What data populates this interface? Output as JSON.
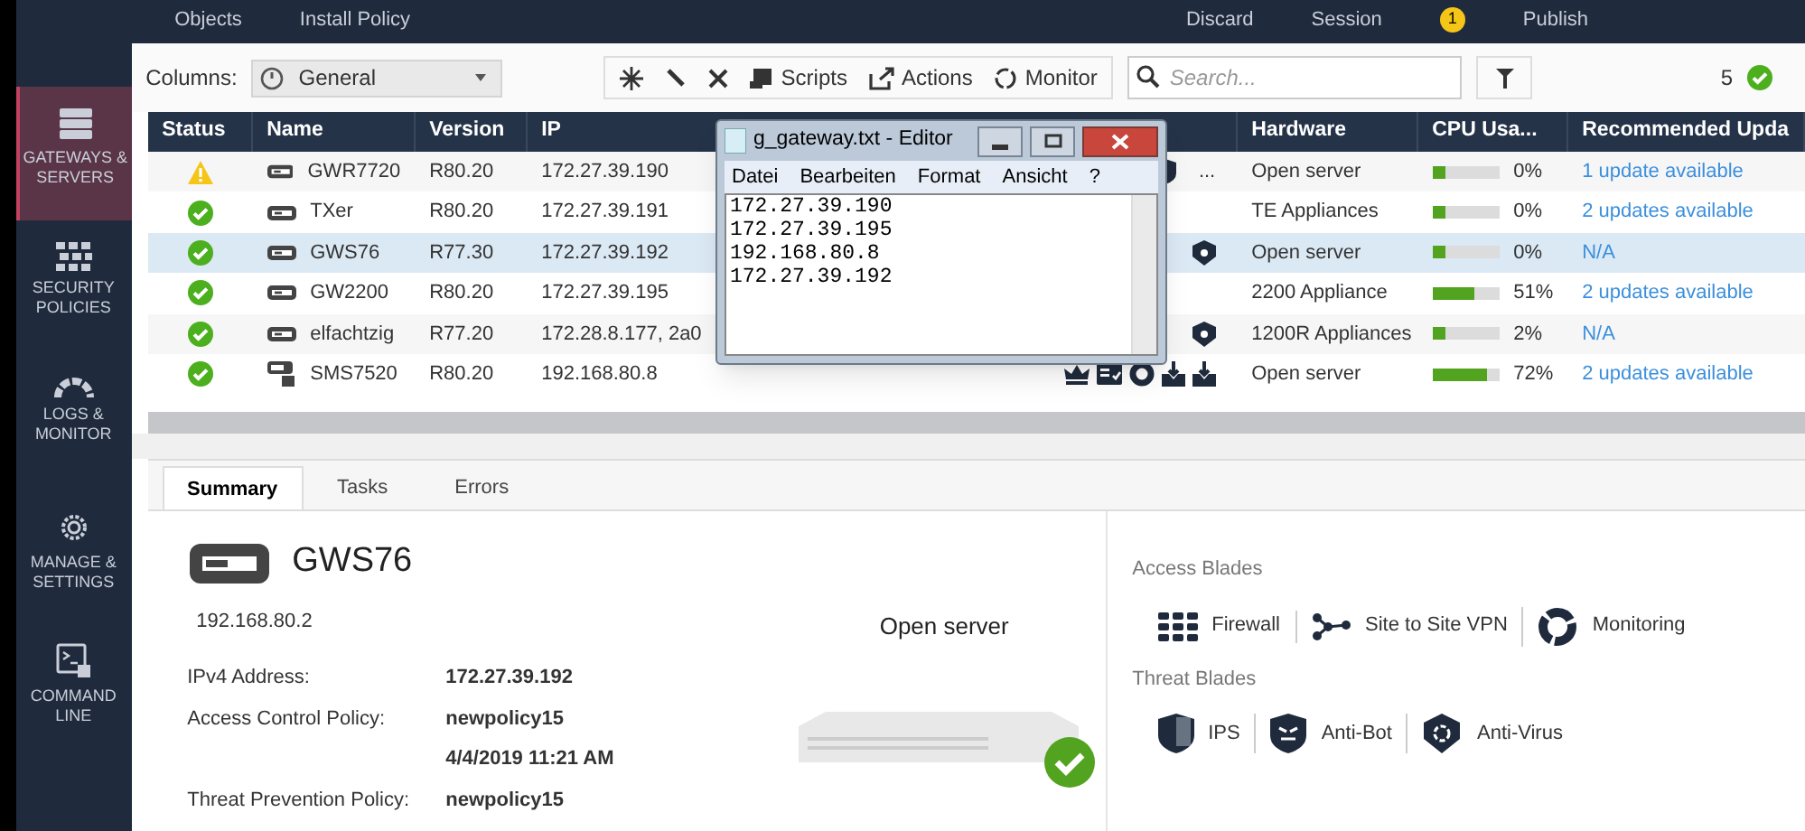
{
  "top_bar": {
    "left_items": [
      "Objects",
      "Install Policy"
    ],
    "right_items": [
      "Discard",
      "Session"
    ],
    "session_badge": "1",
    "publish": "Publish"
  },
  "sidebar": {
    "items": [
      {
        "label": "GATEWAYS & SERVERS",
        "kind": "servers",
        "selected": true
      },
      {
        "label": "SECURITY POLICIES",
        "kind": "policies",
        "selected": false
      },
      {
        "label": "LOGS & MONITOR",
        "kind": "gauge",
        "selected": false
      },
      {
        "label": "MANAGE & SETTINGS",
        "kind": "gear",
        "selected": false
      },
      {
        "label": "COMMAND LINE",
        "kind": "terminal",
        "selected": false
      }
    ]
  },
  "toolbar": {
    "columns_label": "Columns:",
    "columns_value": "General",
    "scripts": "Scripts",
    "actions": "Actions",
    "monitor": "Monitor",
    "search_placeholder": "Search...",
    "count": "5"
  },
  "table": {
    "columns": [
      "Status",
      "Name",
      "Version",
      "IP",
      "Hardware",
      "CPU Usa...",
      "Recommended Upda"
    ],
    "rows": [
      {
        "status": {
          "kind": "warning"
        },
        "device": {
          "kind": "gateway"
        },
        "name": "GWR7720",
        "version": "R80.20",
        "ip": "172.27.39.190",
        "blades": [
          {
            "kind": "shield"
          }
        ],
        "blades_more": "...",
        "hardware": "Open server",
        "level": 0.2,
        "cpu": "0%",
        "update": "1 update available",
        "selected": false
      },
      {
        "status": {
          "kind": "ok"
        },
        "device": {
          "kind": "gateway"
        },
        "name": "TXer",
        "version": "R80.20",
        "ip": "172.27.39.191",
        "blades": [],
        "hardware": "TE Appliances",
        "level": 0.2,
        "cpu": "0%",
        "update": "2 updates available",
        "selected": false
      },
      {
        "status": {
          "kind": "ok"
        },
        "device": {
          "kind": "gateway"
        },
        "name": "GWS76",
        "version": "R77.30",
        "ip": "172.27.39.192",
        "blades": [
          {
            "kind": "badge"
          }
        ],
        "hardware": "Open server",
        "level": 0.2,
        "cpu": "0%",
        "update": "N/A",
        "selected": true
      },
      {
        "status": {
          "kind": "ok"
        },
        "device": {
          "kind": "gateway"
        },
        "name": "GW2200",
        "version": "R80.20",
        "ip": "172.27.39.195",
        "blades": [],
        "hardware": "2200 Appliance",
        "level": 0.62,
        "cpu": "51%",
        "update": "2 updates available",
        "selected": false
      },
      {
        "status": {
          "kind": "ok"
        },
        "device": {
          "kind": "gateway"
        },
        "name": "elfachtzig",
        "version": "R77.20",
        "ip": "172.28.8.177, 2a0",
        "blades": [
          {
            "kind": "badge"
          }
        ],
        "hardware": "1200R Appliances",
        "level": 0.2,
        "cpu": "2%",
        "update": "N/A",
        "selected": false
      },
      {
        "status": {
          "kind": "ok"
        },
        "device": {
          "kind": "server"
        },
        "name": "SMS7520",
        "version": "R80.20",
        "ip": "192.168.80.8",
        "blades": [
          {
            "kind": "crown"
          },
          {
            "kind": "card"
          },
          {
            "kind": "ring"
          },
          {
            "kind": "tray"
          },
          {
            "kind": "tray"
          }
        ],
        "hardware": "Open server",
        "level": 0.82,
        "cpu": "72%",
        "update": "2 updates available",
        "selected": false
      }
    ]
  },
  "editor": {
    "title": "g_gateway.txt - Editor",
    "menu": [
      "Datei",
      "Bearbeiten",
      "Format",
      "Ansicht",
      "?"
    ],
    "lines": [
      "172.27.39.190",
      "172.27.39.195",
      "192.168.80.8",
      "172.27.39.192"
    ]
  },
  "details": {
    "tabs": [
      {
        "label": "Summary",
        "selected": true
      },
      {
        "label": "Tasks",
        "selected": false
      },
      {
        "label": "Errors",
        "selected": false
      }
    ],
    "name": "GWS76",
    "ip": "192.168.80.2",
    "hardware": "Open server",
    "fields": [
      {
        "label": "IPv4 Address:",
        "value": "172.27.39.192"
      },
      {
        "label": "Access Control Policy:",
        "value": "newpolicy15"
      },
      {
        "value": "4/4/2019 11:21 AM"
      },
      {
        "label": "Threat Prevention Policy:",
        "value": "newpolicy15"
      }
    ],
    "access_title": "Access Blades",
    "access_blades": [
      {
        "label": "Firewall",
        "kind": "firewall"
      },
      {
        "label": "Site to Site VPN",
        "kind": "vpn"
      },
      {
        "label": "Monitoring",
        "kind": "monitoring"
      }
    ],
    "threat_title": "Threat Blades",
    "threat_blades": [
      {
        "label": "IPS",
        "kind": "ips"
      },
      {
        "label": "Anti-Bot",
        "kind": "antibot"
      },
      {
        "label": "Anti-Virus",
        "kind": "antivirus"
      }
    ]
  }
}
